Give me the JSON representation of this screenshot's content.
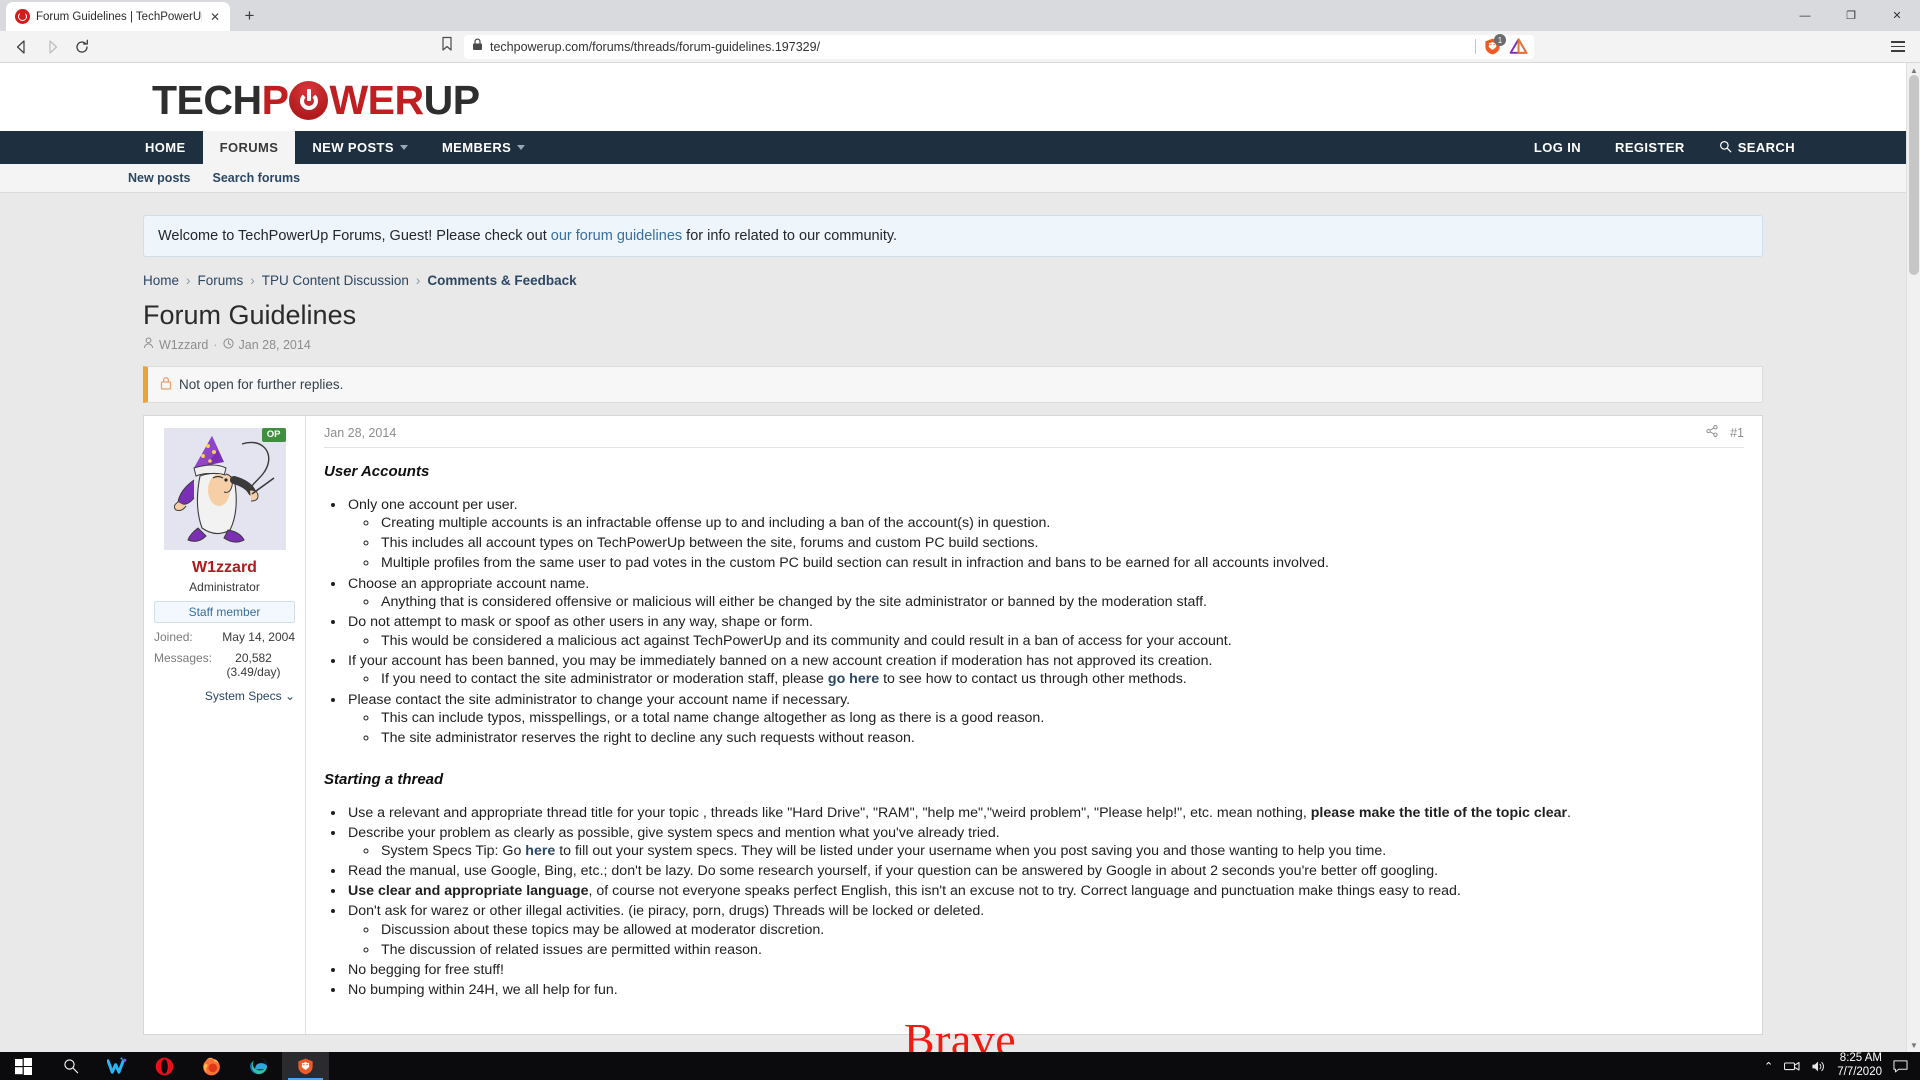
{
  "browser": {
    "tab": {
      "title": "Forum Guidelines | TechPowerUp F",
      "close_label": "✕",
      "favicon": "tpu-power-icon"
    },
    "newtab_label": "+",
    "window_controls": {
      "minimize": "—",
      "maximize": "❐",
      "close": "✕"
    },
    "nav": {
      "back": "back-icon",
      "forward": "forward-icon",
      "reload": "reload-icon"
    },
    "omnibox": {
      "url": "techpowerup.com/forums/threads/forum-guidelines.197329/",
      "lock": "lock-icon",
      "bookmark": "bookmark-icon"
    },
    "shield": {
      "name": "brave-shields-icon",
      "badge": "1"
    },
    "extension": {
      "name": "extension-triangle-icon"
    },
    "menu_label": "hamburger-menu-icon",
    "watermark": "Brave"
  },
  "site": {
    "logo": {
      "part1": "TECH",
      "part2": "P",
      "part3": "WER",
      "part4": "UP"
    },
    "nav_items": [
      {
        "label": "HOME",
        "active": false,
        "caret": false
      },
      {
        "label": "FORUMS",
        "active": true,
        "caret": false
      },
      {
        "label": "NEW POSTS",
        "active": false,
        "caret": true
      },
      {
        "label": "MEMBERS",
        "active": false,
        "caret": true
      }
    ],
    "nav_right": [
      {
        "label": "LOG IN"
      },
      {
        "label": "REGISTER"
      },
      {
        "label": "SEARCH",
        "icon": "search-icon"
      }
    ],
    "subnav": [
      "New posts",
      "Search forums"
    ],
    "notice": {
      "pre": "Welcome to TechPowerUp Forums, Guest! Please check out ",
      "link": "our forum guidelines",
      "post": " for info related to our community."
    },
    "breadcrumb": [
      "Home",
      "Forums",
      "TPU Content Discussion",
      "Comments & Feedback"
    ],
    "breadcrumb_sep": "›",
    "accent_color": "#1e2f40",
    "brand_red": "#c01f22"
  },
  "thread": {
    "title": "Forum Guidelines",
    "author": "W1zzard",
    "date": "Jan 28, 2014",
    "meta_dot": "·",
    "locked_notice": "Not open for further replies.",
    "locked_icon": "lock-icon"
  },
  "post": {
    "head": {
      "date": "Jan 28, 2014",
      "share_icon": "share-icon",
      "number": "#1"
    },
    "author": {
      "avatar": "wizard-avatar",
      "op_badge": "OP",
      "username": "W1zzard",
      "title": "Administrator",
      "staff_badge": "Staff member",
      "stats": [
        {
          "label": "Joined:",
          "value": "May 14, 2004"
        },
        {
          "label": "Messages:",
          "value": "20,582 (3.49/day)"
        }
      ],
      "system_specs": "System Specs",
      "system_specs_caret": "⌄"
    },
    "sections": [
      {
        "heading": "User Accounts",
        "items": [
          {
            "text": "Only one account per user.",
            "sub": [
              "Creating multiple accounts is an infractable offense up to and including a ban of the account(s) in question.",
              "This includes all account types on TechPowerUp between the site, forums and custom PC build sections.",
              "Multiple profiles from the same user to pad votes in the custom PC build section can result in infraction and bans to be earned for all accounts involved."
            ]
          },
          {
            "text": "Choose an appropriate account name.",
            "sub": [
              "Anything that is considered offensive or malicious will either be changed by the site administrator or banned by the moderation staff."
            ]
          },
          {
            "text": "Do not attempt to mask or spoof as other users in any way, shape or form.",
            "sub": [
              "This would be considered a malicious act against TechPowerUp and its community and could result in a ban of access for your account."
            ]
          },
          {
            "text": "If your account has been banned, you may be immediately banned on a new account creation if moderation has not approved its creation.",
            "sub_html": [
              "If you need to contact the site administrator or moderation staff, please <a>go here</a> to see how to contact us through other methods."
            ]
          },
          {
            "text": "Please contact the site administrator to change your account name if necessary.",
            "sub": [
              "This can include typos, misspellings, or a total name change altogether as long as there is a good reason.",
              "The site administrator reserves the right to decline any such requests without reason."
            ]
          }
        ]
      },
      {
        "heading": "Starting a thread",
        "items": [
          {
            "html": "Use a relevant and appropriate thread title for your topic , threads like \"Hard Drive\", \"RAM\", \"help me\",\"weird problem\", \"Please help!\", etc. mean nothing, <b>please make the title of the topic clear</b>."
          },
          {
            "text": "Describe your problem as clearly as possible, give system specs and mention what you've already tried.",
            "sub_html": [
              "System Specs Tip: Go <a>here</a> to fill out your system specs. They will be listed under your username when you post saving you and those wanting to help you time."
            ]
          },
          {
            "text": "Read the manual, use Google, Bing, etc.; don't be lazy. Do some research yourself, if your question can be answered by Google in about 2 seconds you're better off googling."
          },
          {
            "html": "<b>Use clear and appropriate language</b>, of course not everyone speaks perfect English, this isn't an excuse not to try. Correct language and punctuation make things easy to read."
          },
          {
            "text": "Don't ask for warez or other illegal activities. (ie piracy, porn, drugs) Threads will be locked or deleted.",
            "sub": [
              "Discussion about these topics may be allowed at moderator discretion.",
              "The discussion of related issues are permitted within reason."
            ]
          },
          {
            "text": "No begging for free stuff!"
          },
          {
            "text": "No bumping within 24H, we all help for fun."
          }
        ]
      }
    ]
  },
  "taskbar": {
    "items": [
      {
        "name": "start-button",
        "icon": "windows-logo-icon"
      },
      {
        "name": "search-button",
        "icon": "search-icon"
      },
      {
        "name": "taskbar-app-wavebox",
        "icon": "wavebox-icon"
      },
      {
        "name": "taskbar-app-opera",
        "icon": "opera-icon"
      },
      {
        "name": "taskbar-app-firefox",
        "icon": "firefox-icon"
      },
      {
        "name": "taskbar-app-edge",
        "icon": "edge-icon"
      },
      {
        "name": "taskbar-app-brave",
        "icon": "brave-lion-icon",
        "active": true
      }
    ],
    "tray": {
      "chevron": "⌃",
      "network": "network-icon",
      "volume": "volume-icon",
      "time": "8:25 AM",
      "date": "7/7/2020",
      "action_center": "action-center-icon"
    }
  }
}
